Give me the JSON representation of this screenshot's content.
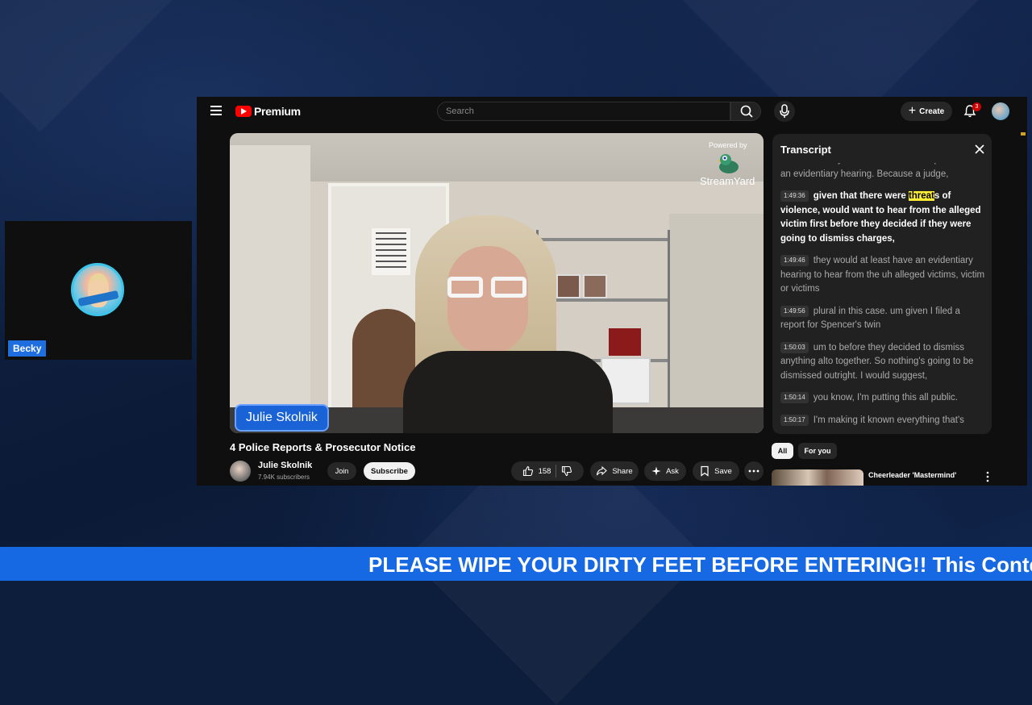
{
  "webcam": {
    "name_label": "Becky",
    "avatar_icon": "profile-avatar-icon"
  },
  "youtube": {
    "logo_text": "Premium",
    "search": {
      "placeholder": "Search"
    },
    "create_label": "Create",
    "notification_count": "3",
    "video": {
      "powered_by": "Powered by",
      "brand": "StreamYard",
      "name_tag": "Julie Skolnik"
    },
    "transcript": {
      "title": "Transcript",
      "partial_text": "least what they call an EV what he explained was an evidentiary hearing. Because a judge,",
      "segments": [
        {
          "time": "1:49:36",
          "text_before": "given that there were ",
          "highlight": "threat",
          "text_after": "s of violence, would want to hear from the alleged victim first before they decided if they were going to dismiss charges,",
          "active": true
        },
        {
          "time": "1:49:46",
          "text": "they would at least have an evidentiary hearing to hear from the uh alleged victims, victim or victims"
        },
        {
          "time": "1:49:56",
          "text": "plural in this case. um given I filed a report for Spencer's twin"
        },
        {
          "time": "1:50:03",
          "text": "um to before they decided to dismiss anything alto together. So nothing's going to be dismissed outright. I would suggest,"
        },
        {
          "time": "1:50:14",
          "text": "you know, I'm putting this all public."
        },
        {
          "time": "1:50:17",
          "text": "I'm making it known everything that's"
        }
      ]
    },
    "video_title": "4 Police Reports & Prosecutor Notice",
    "channel": {
      "name": "Julie Skolnik",
      "subscribers": "7.94K subscribers"
    },
    "join_label": "Join",
    "subscribe_label": "Subscribe",
    "like_count": "158",
    "share_label": "Share",
    "ask_label": "Ask",
    "save_label": "Save",
    "chips": [
      "All",
      "For you"
    ],
    "recommended": {
      "title": "Cheerleader 'Mastermind'"
    }
  },
  "ticker": {
    "text": "PLEASE WIPE YOUR DIRTY FEET BEFORE ENTERING!! This Content"
  },
  "colors": {
    "ticker_bg": "#1668e3",
    "youtube_red": "#ff0000",
    "highlight": "#ffee33",
    "name_tag": "#1a63d6"
  }
}
